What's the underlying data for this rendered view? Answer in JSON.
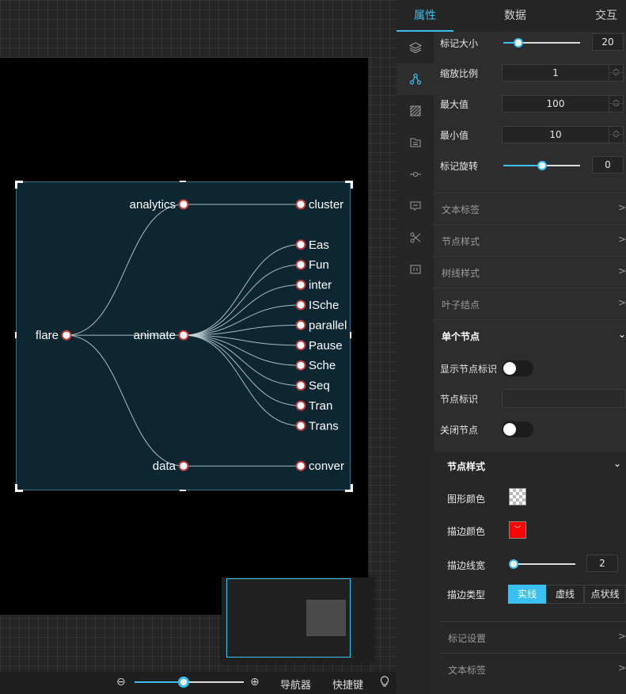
{
  "colors": {
    "accent": "#39c0f0",
    "node_stroke": "#c23b3b",
    "link": "#c8d6dc",
    "chart_bg": "#0c2731"
  },
  "tree": {
    "root": "flare",
    "branches": [
      {
        "name": "analytics",
        "children": [
          "cluster"
        ]
      },
      {
        "name": "animate",
        "children": [
          "Eas",
          "Fun",
          "inter",
          "ISche",
          "parallel",
          "Pause",
          "Sche",
          "Seq",
          "Tran",
          "Trans"
        ]
      },
      {
        "name": "data",
        "children": [
          "conver"
        ]
      }
    ]
  },
  "bottom_bar": {
    "zoom_value": 0.45,
    "navigator_label": "导航器",
    "shortcuts_label": "快捷键"
  },
  "tabs": [
    {
      "label": "属性"
    },
    {
      "label": "数据"
    },
    {
      "label": "交互"
    }
  ],
  "icons": [
    "layers-icon",
    "nodes-icon",
    "texture-icon",
    "folder-icon",
    "link-icon",
    "tooltip-icon",
    "scissors-icon",
    "dimension-icon"
  ],
  "props": {
    "marker_size": {
      "label": "标记大小",
      "value": "20",
      "fraction": 0.2
    },
    "scale": {
      "label": "缩放比例",
      "value": "1"
    },
    "max": {
      "label": "最大值",
      "value": "100"
    },
    "min": {
      "label": "最小值",
      "value": "10"
    },
    "rotate": {
      "label": "标记旋转",
      "value": "0",
      "fraction": 0.5
    }
  },
  "sections": {
    "text_label": "文本标签",
    "node_style": "节点样式",
    "tree_line_style": "树线样式",
    "leaf_node": "叶子结点",
    "single_node": "单个节点"
  },
  "single_node": {
    "show_label": "显示节点标识",
    "node_id": "节点标识",
    "close_node": "关闭节点",
    "style": {
      "title": "节点样式",
      "fill_label": "图形颜色",
      "stroke_label": "描边颜色",
      "stroke_color": "#ff0000",
      "width_label": "描边线宽",
      "width_value": "2",
      "width_fraction": 0.03,
      "type_label": "描边类型",
      "types": [
        "实线",
        "虚线",
        "点状线"
      ],
      "marker_settings": "标记设置",
      "text_label": "文本标签"
    }
  }
}
